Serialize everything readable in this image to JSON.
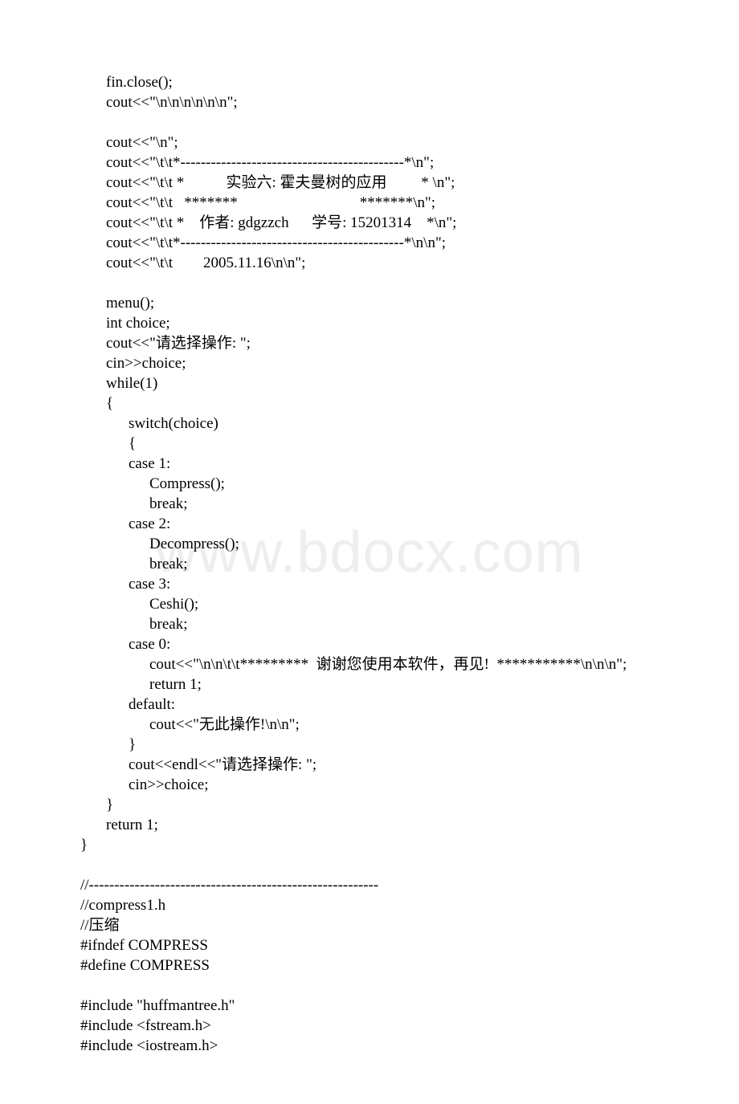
{
  "watermark": "www.bdocx.com",
  "lines": [
    {
      "indent": 1,
      "text": "fin.close();"
    },
    {
      "indent": 1,
      "text": "cout<<\"\\n\\n\\n\\n\\n\\n\";"
    },
    {
      "blank": true
    },
    {
      "indent": 1,
      "text": "cout<<\"\\n\";"
    },
    {
      "indent": 1,
      "text": "cout<<\"\\t\\t*--------------------------------------------*\\n\";"
    },
    {
      "indent": 1,
      "text": "cout<<\"\\t\\t *           实验六: 霍夫曼树的应用         * \\n\";"
    },
    {
      "indent": 1,
      "text": "cout<<\"\\t\\t   *******                                *******\\n\";"
    },
    {
      "indent": 1,
      "text": "cout<<\"\\t\\t *    作者: gdgzzch      学号: 15201314    *\\n\";"
    },
    {
      "indent": 1,
      "text": "cout<<\"\\t\\t*--------------------------------------------*\\n\\n\";"
    },
    {
      "indent": 1,
      "text": "cout<<\"\\t\\t        2005.11.16\\n\\n\";"
    },
    {
      "blank": true
    },
    {
      "indent": 1,
      "text": "menu();"
    },
    {
      "indent": 1,
      "text": "int choice;"
    },
    {
      "indent": 1,
      "text": "cout<<\"请选择操作: \";"
    },
    {
      "indent": 1,
      "text": "cin>>choice;"
    },
    {
      "indent": 1,
      "text": "while(1)"
    },
    {
      "indent": 1,
      "text": "{"
    },
    {
      "indent": 2,
      "text": "switch(choice)"
    },
    {
      "indent": 2,
      "text": "{"
    },
    {
      "indent": 2,
      "text": "case 1:"
    },
    {
      "indent": 3,
      "text": "Compress();"
    },
    {
      "indent": 3,
      "text": "break;"
    },
    {
      "indent": 2,
      "text": "case 2:"
    },
    {
      "indent": 3,
      "text": "Decompress();"
    },
    {
      "indent": 3,
      "text": "break;"
    },
    {
      "indent": 2,
      "text": "case 3:"
    },
    {
      "indent": 3,
      "text": "Ceshi();"
    },
    {
      "indent": 3,
      "text": "break;"
    },
    {
      "indent": 2,
      "text": "case 0:"
    },
    {
      "indent": 3,
      "text": "cout<<\"\\n\\n\\t\\t*********  谢谢您使用本软件，再见!  ***********\\n\\n\\n\";"
    },
    {
      "indent": 3,
      "text": "return 1;"
    },
    {
      "indent": 2,
      "text": "default:"
    },
    {
      "indent": 3,
      "text": "cout<<\"无此操作!\\n\\n\";"
    },
    {
      "indent": 2,
      "text": "}"
    },
    {
      "indent": 2,
      "text": "cout<<endl<<\"请选择操作: \";"
    },
    {
      "indent": 2,
      "text": "cin>>choice;"
    },
    {
      "indent": 1,
      "text": "}"
    },
    {
      "indent": 1,
      "text": "return 1;"
    },
    {
      "indent": 0,
      "text": "}"
    },
    {
      "blank": true
    },
    {
      "indent": 0,
      "text": "//---------------------------------------------------------"
    },
    {
      "indent": 0,
      "text": "//compress1.h"
    },
    {
      "indent": 0,
      "text": "//压缩"
    },
    {
      "indent": 0,
      "text": "#ifndef COMPRESS"
    },
    {
      "indent": 0,
      "text": "#define COMPRESS"
    },
    {
      "blank": true
    },
    {
      "indent": 0,
      "text": "#include \"huffmantree.h\""
    },
    {
      "indent": 0,
      "text": "#include <fstream.h>"
    },
    {
      "indent": 0,
      "text": "#include <iostream.h>"
    }
  ]
}
